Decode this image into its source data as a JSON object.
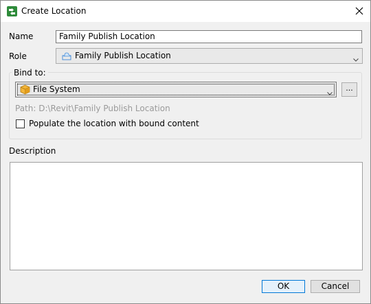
{
  "window": {
    "title": "Create Location",
    "icons": {
      "app": "location-app-icon",
      "close": "close-icon"
    }
  },
  "form": {
    "name_label": "Name",
    "name_value": "Family Publish Location",
    "role_label": "Role",
    "role_value": "Family Publish Location",
    "role_icon": "cloud-folder-icon",
    "bind_to": {
      "label": "Bind to:",
      "value": "File System",
      "icon": "file-system-cube-icon",
      "browse_label": "...",
      "path_text": "Path: D:\\Revit\\Family Publish Location",
      "populate_label": "Populate the location with bound content",
      "populate_checked": false
    },
    "description_label": "Description",
    "description_value": ""
  },
  "buttons": {
    "ok": "OK",
    "cancel": "Cancel"
  },
  "colors": {
    "app_icon": "#2e8b3a",
    "focus_border": "#0078d7",
    "disabled_text": "#9a9a9a"
  }
}
